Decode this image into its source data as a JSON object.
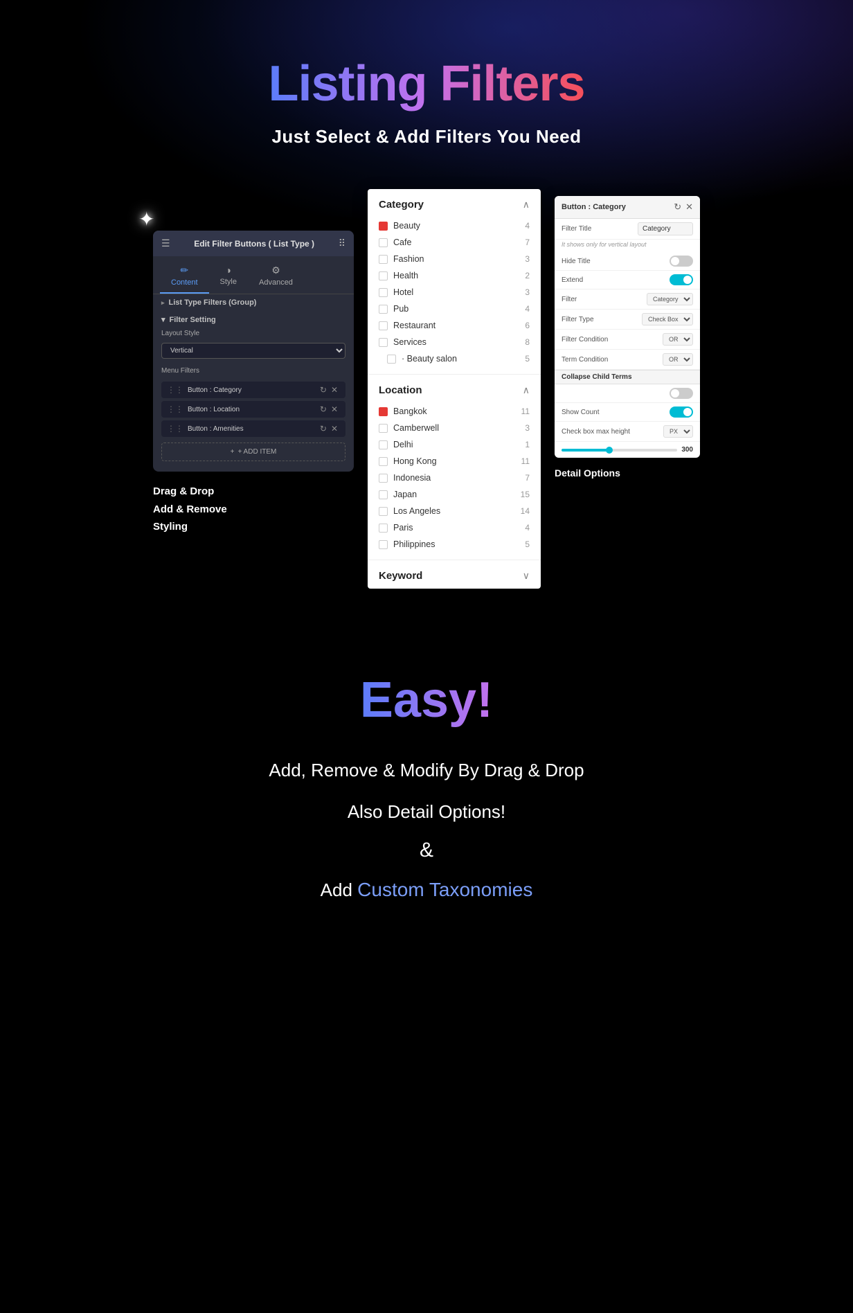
{
  "page": {
    "title": "Listing Filters",
    "subtitle": "Just Select & Add Filters You Need",
    "easy_title": "Easy!",
    "bottom_lines": [
      "Add, Remove & Modify By Drag & Drop",
      "Also Detail Options!",
      "&",
      "Add "
    ],
    "custom_tax_label": "Custom Taxonomies"
  },
  "left_panel": {
    "header_title": "Edit Filter Buttons ( List Type )",
    "tabs": [
      {
        "label": "Content",
        "active": true
      },
      {
        "label": "Style",
        "active": false
      },
      {
        "label": "Advanced",
        "active": false
      }
    ],
    "group_label": "List Type Filters (Group)",
    "filter_setting_label": "Filter Setting",
    "layout_label": "Layout Style",
    "layout_value": "Vertical",
    "menu_filters_label": "Menu Filters",
    "filter_items": [
      {
        "label": "Button : Category"
      },
      {
        "label": "Button : Location"
      },
      {
        "label": "Button : Amenities"
      }
    ],
    "add_item_label": "+ ADD ITEM",
    "drag_drop_text": "Drag & Drop\nAdd & Remove\nStyling"
  },
  "middle_panel": {
    "category_section": {
      "title": "Category",
      "items": [
        {
          "name": "Beauty",
          "count": "4",
          "checked": true
        },
        {
          "name": "Cafe",
          "count": "7",
          "checked": false
        },
        {
          "name": "Fashion",
          "count": "3",
          "checked": false
        },
        {
          "name": "Health",
          "count": "2",
          "checked": false
        },
        {
          "name": "Hotel",
          "count": "3",
          "checked": false
        },
        {
          "name": "Pub",
          "count": "4",
          "checked": false
        },
        {
          "name": "Restaurant",
          "count": "6",
          "checked": false
        },
        {
          "name": "Services",
          "count": "8",
          "checked": false
        },
        {
          "name": "· Beauty salon",
          "count": "5",
          "checked": false,
          "indent": true
        }
      ]
    },
    "location_section": {
      "title": "Location",
      "items": [
        {
          "name": "Bangkok",
          "count": "11",
          "checked": true
        },
        {
          "name": "Camberwell",
          "count": "3",
          "checked": false
        },
        {
          "name": "Delhi",
          "count": "1",
          "checked": false
        },
        {
          "name": "Hong Kong",
          "count": "11",
          "checked": false
        },
        {
          "name": "Indonesia",
          "count": "7",
          "checked": false
        },
        {
          "name": "Japan",
          "count": "15",
          "checked": false
        },
        {
          "name": "Los Angeles",
          "count": "14",
          "checked": false
        },
        {
          "name": "Paris",
          "count": "4",
          "checked": false
        },
        {
          "name": "Philippines",
          "count": "5",
          "checked": false
        }
      ]
    },
    "keyword_section": {
      "title": "Keyword"
    }
  },
  "right_panel": {
    "header_title": "Button : Category",
    "filter_title_label": "Filter Title",
    "filter_title_value": "Category",
    "note": "It shows only for vertical layout",
    "hide_title_label": "Hide Title",
    "hide_title_value": "off",
    "extend_label": "Extend",
    "extend_value": "on",
    "filter_label": "Filter",
    "filter_value": "Category",
    "filter_type_label": "Filter Type",
    "filter_type_value": "Check Box",
    "filter_condition_label": "Filter Condition",
    "filter_condition_value": "OR",
    "term_condition_label": "Term Condition",
    "term_condition_value": "OR",
    "collapse_child_label": "Collapse Child Terms",
    "collapse_child_value": "off",
    "show_count_label": "Show Count",
    "show_count_value": "on",
    "checkbox_max_height_label": "Check box max height",
    "checkbox_max_height_unit": "PX",
    "slider_value": "300",
    "detail_options_label": "Detail Options"
  },
  "icons": {
    "hamburger": "☰",
    "grid": "⠿",
    "pencil": "✏",
    "style": "◑",
    "gear": "⚙",
    "refresh": "↻",
    "close": "✕",
    "chevron_up": "⌃",
    "chevron_down": "⌄",
    "plus": "+",
    "arrow": "▸",
    "drag": "⋮⋮"
  }
}
